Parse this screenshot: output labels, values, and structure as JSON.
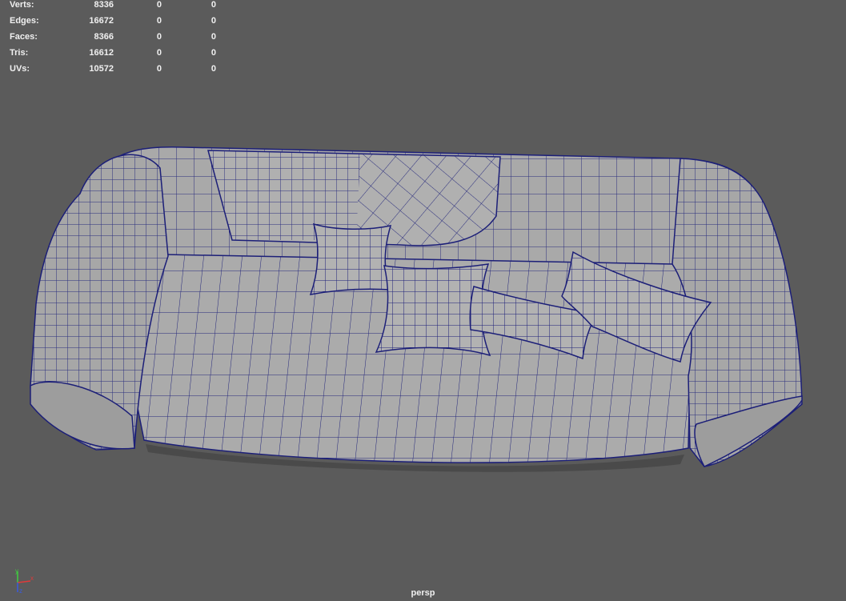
{
  "hud": {
    "rows": [
      {
        "label": "Verts:",
        "total": "8336",
        "selected": "0",
        "component": "0"
      },
      {
        "label": "Edges:",
        "total": "16672",
        "selected": "0",
        "component": "0"
      },
      {
        "label": "Faces:",
        "total": "8366",
        "selected": "0",
        "component": "0"
      },
      {
        "label": "Tris:",
        "total": "16612",
        "selected": "0",
        "component": "0"
      },
      {
        "label": "UVs:",
        "total": "10572",
        "selected": "0",
        "component": "0"
      }
    ]
  },
  "viewport": {
    "camera_label": "persp",
    "background": "#5b5b5b",
    "mesh_fill": "#a9a9a9",
    "wire_color": "#1c1f78",
    "axis": {
      "x": "x",
      "y": "y",
      "z": "z"
    }
  }
}
